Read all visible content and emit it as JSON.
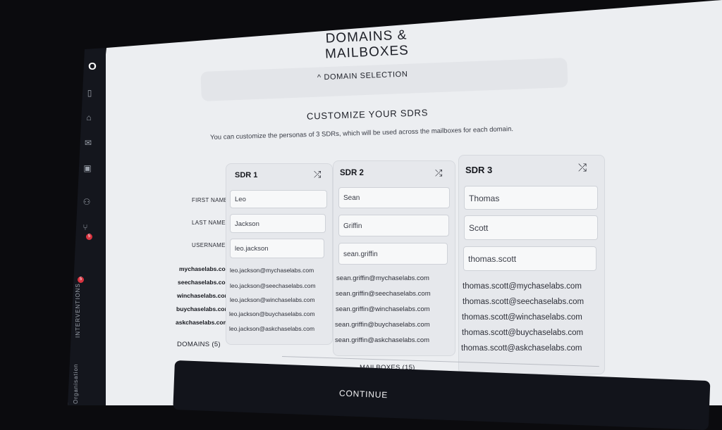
{
  "page": {
    "title": "DOMAINS & MAILBOXES",
    "domain_selection": "DOMAIN SELECTION",
    "subtitle": "CUSTOMIZE YOUR SDRS",
    "description": "You can customize the personas of 3 SDRs, which will be used across the mailboxes for each domain."
  },
  "sidebar": {
    "logo": "O",
    "icons": [
      "document-icon",
      "home-icon",
      "mail-icon",
      "contact-icon",
      "users-icon",
      "branch-icon"
    ],
    "badge_count": "5",
    "interventions_badge": "5",
    "interventions_label": "INTERVENTIONS",
    "organisation_label": "Organisation"
  },
  "row_labels": {
    "first_name": "FIRST NAME",
    "last_name": "LAST NAME",
    "username": "USERNAME"
  },
  "domains": [
    "mychaselabs.com",
    "seechaselabs.com",
    "winchaselabs.com",
    "buychaselabs.com",
    "askchaselabs.com"
  ],
  "sdrs": [
    {
      "title": "SDR 1",
      "first_name": "Leo",
      "last_name": "Jackson",
      "username": "leo.jackson",
      "emails": [
        "leo.jackson@mychaselabs.com",
        "leo.jackson@seechaselabs.com",
        "leo.jackson@winchaselabs.com",
        "leo.jackson@buychaselabs.com",
        "leo.jackson@askchaselabs.com"
      ]
    },
    {
      "title": "SDR 2",
      "first_name": "Sean",
      "last_name": "Griffin",
      "username": "sean.griffin",
      "emails": [
        "sean.griffin@mychaselabs.com",
        "sean.griffin@seechaselabs.com",
        "sean.griffin@winchaselabs.com",
        "sean.griffin@buychaselabs.com",
        "sean.griffin@askchaselabs.com"
      ]
    },
    {
      "title": "SDR 3",
      "first_name": "Thomas",
      "last_name": "Scott",
      "username": "thomas.scott",
      "emails": [
        "thomas.scott@mychaselabs.com",
        "thomas.scott@seechaselabs.com",
        "thomas.scott@winchaselabs.com",
        "thomas.scott@buychaselabs.com",
        "thomas.scott@askchaselabs.com"
      ]
    }
  ],
  "tabs": {
    "domains": "DOMAINS (5)",
    "mailboxes": "MAILBOXES (15)"
  },
  "continue_label": "CONTINUE",
  "shuffle_glyph": "⤮",
  "chevron_glyph": "^"
}
